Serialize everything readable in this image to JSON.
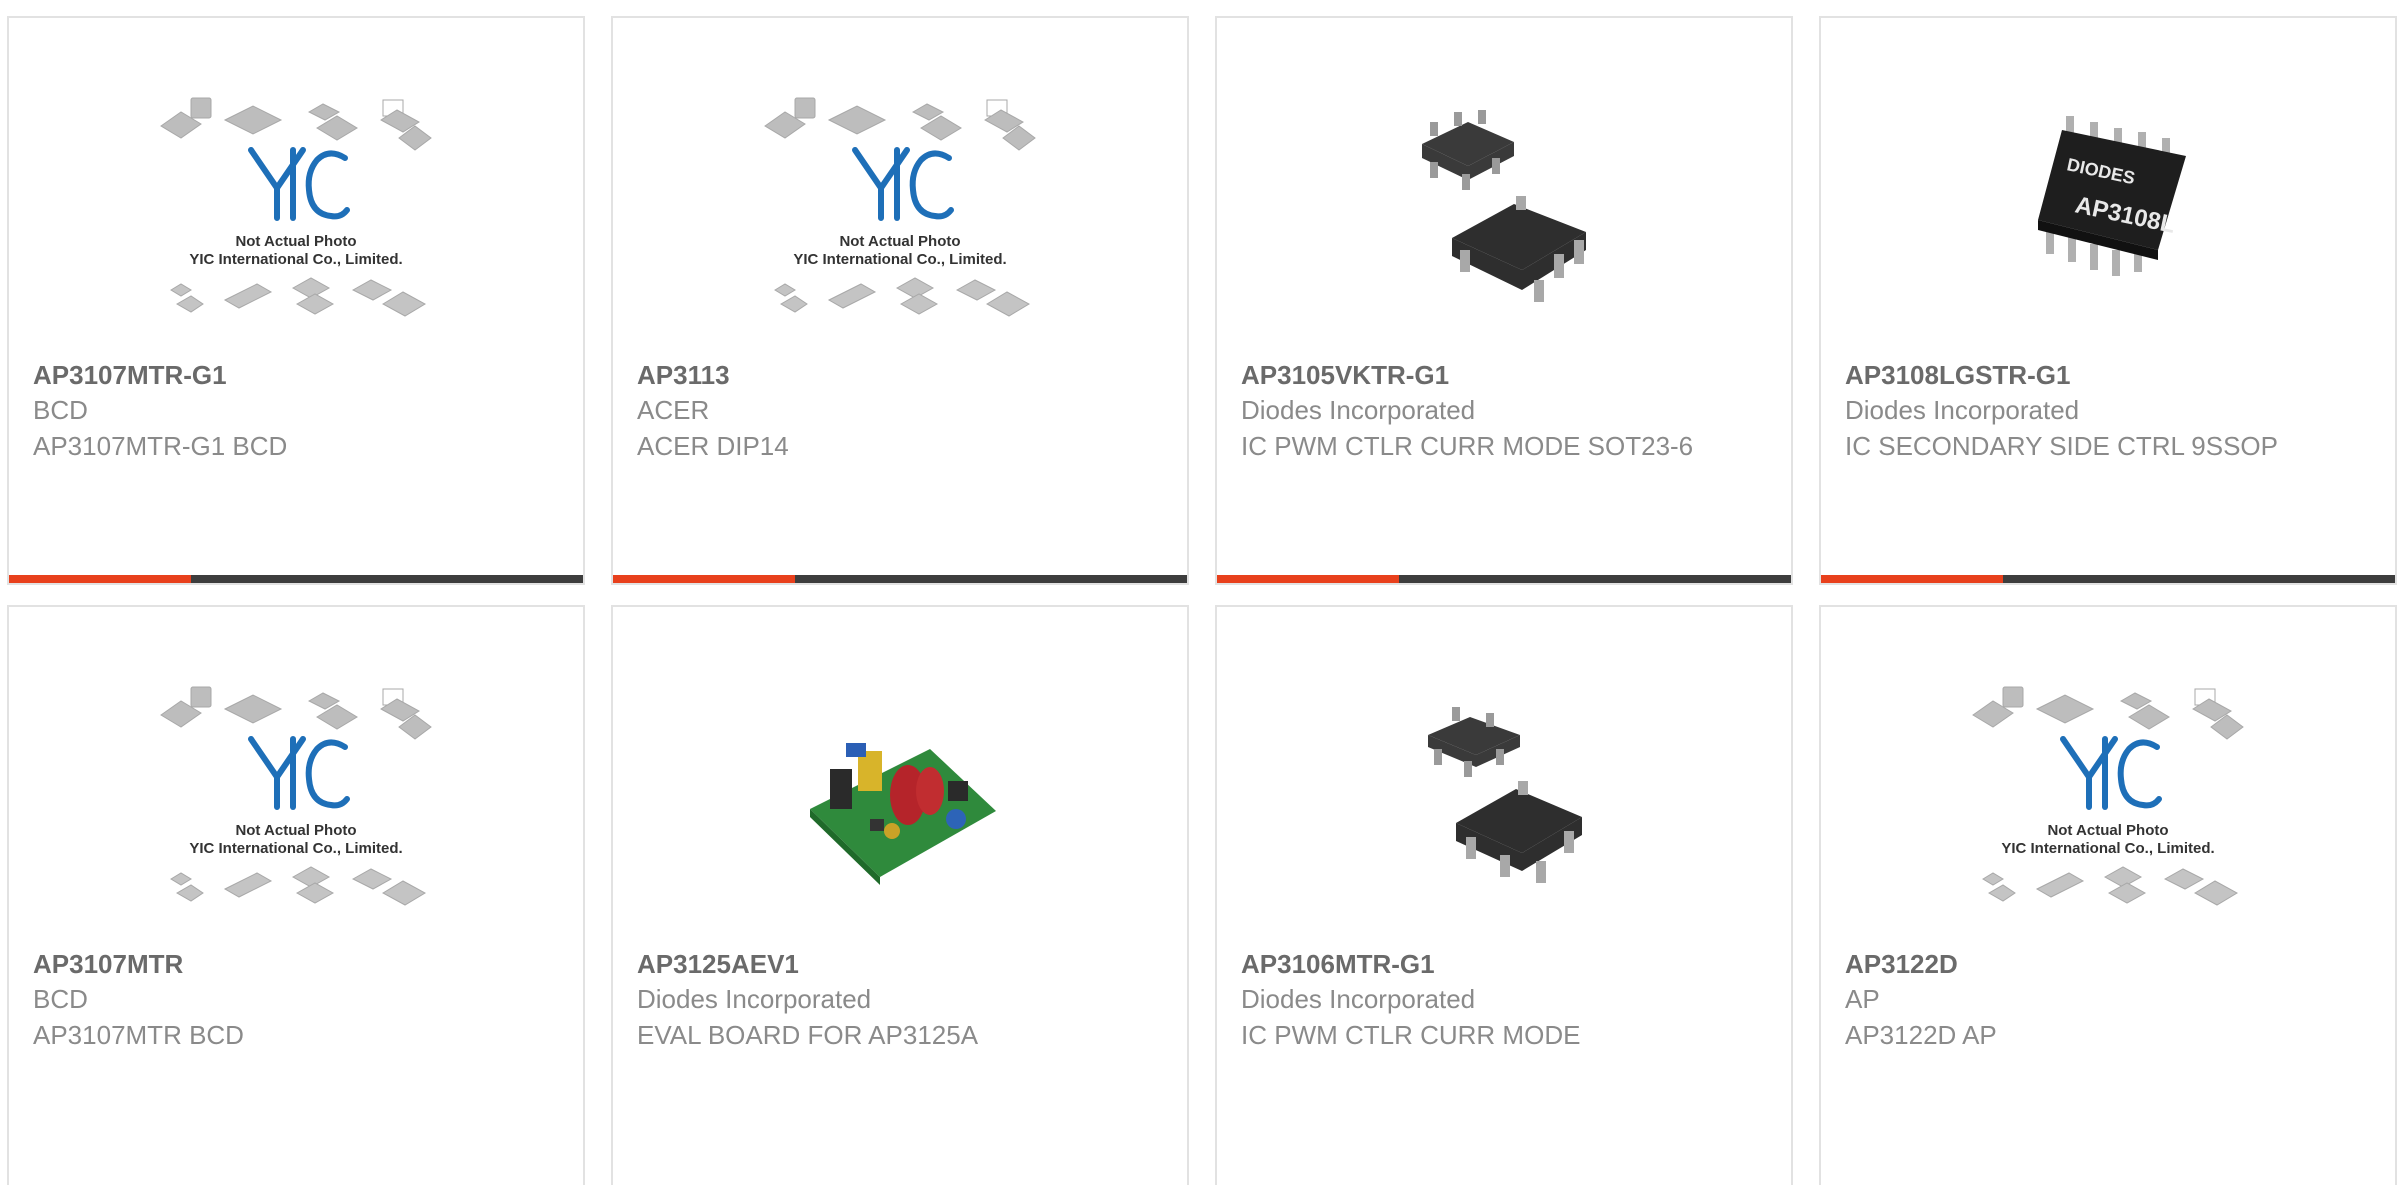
{
  "placeholder": {
    "logo_text": "YIC",
    "line1": "Not Actual Photo",
    "line2": "YIC International Co., Limited."
  },
  "cards": [
    {
      "part": "AP3107MTR-G1",
      "mfr": "BCD",
      "desc": "AP3107MTR-G1 BCD",
      "image": "placeholder-photo"
    },
    {
      "part": "AP3113",
      "mfr": "ACER",
      "desc": "ACER DIP14",
      "image": "placeholder-photo"
    },
    {
      "part": "AP3105VKTR-G1",
      "mfr": "Diodes Incorporated",
      "desc": "IC PWM CTLR CURR MODE SOT23-6",
      "image": "sot23-chip-photo"
    },
    {
      "part": "AP3108LGSTR-G1",
      "mfr": "Diodes Incorporated",
      "desc": "IC SECONDARY SIDE CTRL 9SSOP",
      "image": "ssop-chip-photo",
      "chip_marks": [
        "DIODES",
        "AP3108L"
      ]
    },
    {
      "part": "AP3107MTR",
      "mfr": "BCD",
      "desc": "AP3107MTR BCD",
      "image": "placeholder-photo"
    },
    {
      "part": "AP3125AEV1",
      "mfr": "Diodes Incorporated",
      "desc": "EVAL BOARD FOR AP3125A",
      "image": "eval-board-photo"
    },
    {
      "part": "AP3106MTR-G1",
      "mfr": "Diodes Incorporated",
      "desc": "IC PWM CTLR CURR MODE",
      "image": "sot23-chip-photo"
    },
    {
      "part": "AP3122D",
      "mfr": "AP",
      "desc": "AP3122D AP",
      "image": "placeholder-photo"
    }
  ],
  "colors": {
    "accent": "#e8401c",
    "bar": "#3d3d3d",
    "text_title": "#6a6a6a",
    "text_body": "#8a8a8a",
    "logo_blue": "#1e6fb8"
  }
}
